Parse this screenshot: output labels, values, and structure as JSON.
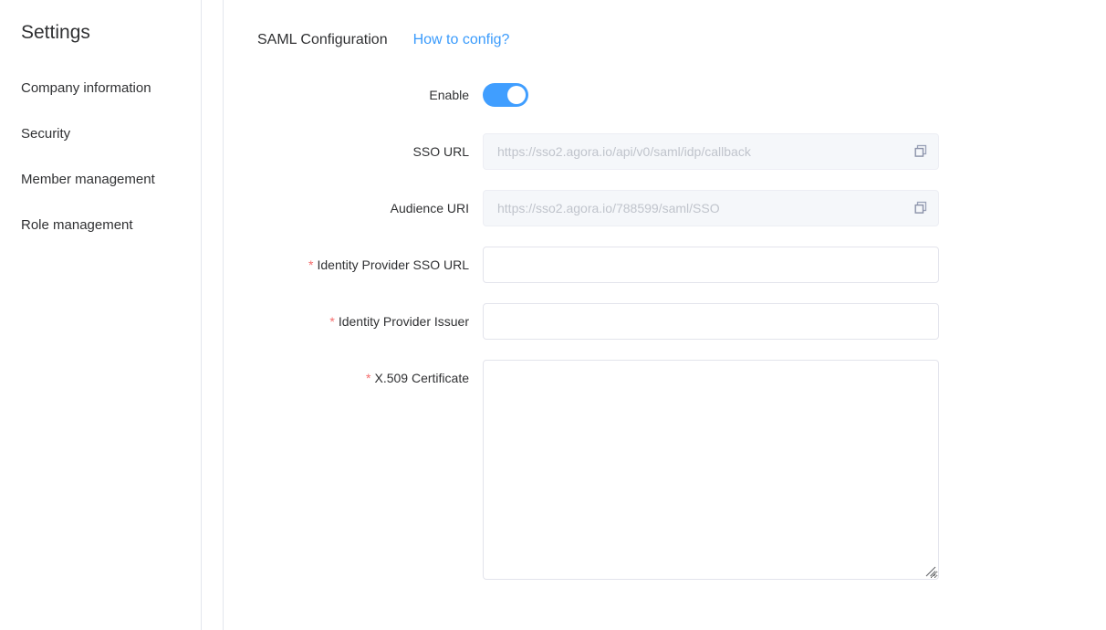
{
  "sidebar": {
    "title": "Settings",
    "items": [
      {
        "label": "Company information"
      },
      {
        "label": "Security"
      },
      {
        "label": "Member management"
      },
      {
        "label": "Role management"
      }
    ]
  },
  "panel": {
    "title": "SAML Configuration",
    "help_link": "How to config?"
  },
  "form": {
    "enable": {
      "label": "Enable",
      "state": "on"
    },
    "sso_url": {
      "label": "SSO URL",
      "value": "https://sso2.agora.io/api/v0/saml/idp/callback",
      "readonly": true,
      "copy_icon": "copy-icon"
    },
    "audience_uri": {
      "label": "Audience URI",
      "value": "https://sso2.agora.io/788599/saml/SSO",
      "readonly": true,
      "copy_icon": "copy-icon"
    },
    "idp_sso_url": {
      "label": "Identity Provider SSO URL",
      "required_mark": "*",
      "value": "",
      "placeholder": ""
    },
    "idp_issuer": {
      "label": "Identity Provider Issuer",
      "required_mark": "*",
      "value": "",
      "placeholder": ""
    },
    "x509_certificate": {
      "label": "X.509 Certificate",
      "required_mark": "*",
      "value": "",
      "placeholder": ""
    }
  },
  "colors": {
    "accent": "#409eff",
    "link": "#3a9bfc",
    "required": "#f56c6c",
    "text": "#303133",
    "placeholder": "#c0c4cc",
    "border": "#e3e4ec",
    "disabled_bg": "#f5f7fa",
    "icon": "#8a91a8"
  }
}
